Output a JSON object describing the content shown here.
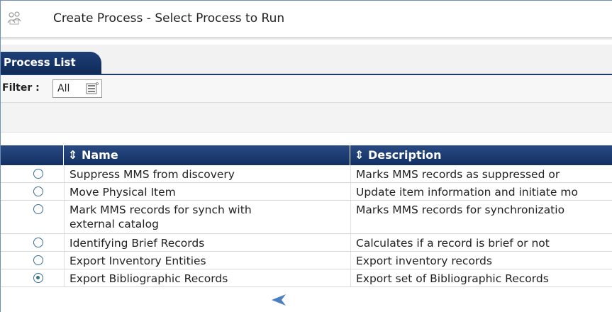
{
  "window": {
    "title": "Create Process - Select Process to Run"
  },
  "tabs": [
    {
      "label": "Process List",
      "active": true
    }
  ],
  "filter": {
    "label": "Filter :",
    "value": "All"
  },
  "table": {
    "columns": [
      "Name",
      "Description"
    ],
    "sort_icon": "sort-updown-icon",
    "rows": [
      {
        "name": "Suppress MMS from discovery",
        "description": "Marks MMS records as suppressed or",
        "selected": false
      },
      {
        "name": "Move Physical Item",
        "description": "Update item information and initiate mo",
        "selected": false
      },
      {
        "name": "Mark MMS records for synch with external catalog",
        "description": "Marks MMS records for synchronizatio",
        "selected": false
      },
      {
        "name": "Identifying Brief Records",
        "description": "Calculates if a record is brief or not",
        "selected": false
      },
      {
        "name": "Export Inventory Entities",
        "description": "Export inventory records",
        "selected": false
      },
      {
        "name": "Export Bibliographic Records",
        "description": "Export set of Bibliographic Records",
        "selected": true
      }
    ]
  },
  "colors": {
    "header_bg": "#1b3a70",
    "arrow": "#4a7fc1",
    "radio": "#3b6e8f"
  }
}
